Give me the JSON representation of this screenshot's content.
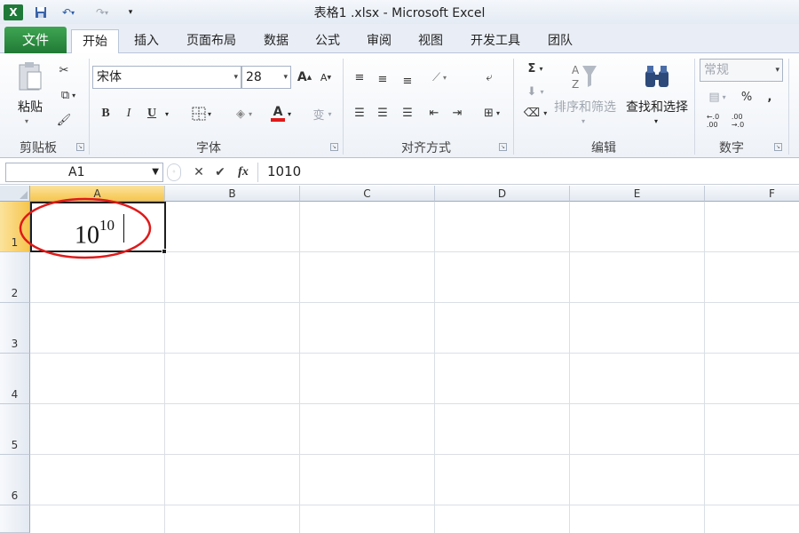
{
  "window": {
    "title": "表格1 .xlsx - Microsoft Excel"
  },
  "tabs": [
    "文件",
    "开始",
    "插入",
    "页面布局",
    "数据",
    "公式",
    "审阅",
    "视图",
    "开发工具",
    "团队"
  ],
  "ribbon": {
    "clipboard": {
      "paste": "粘贴",
      "label": "剪贴板"
    },
    "font": {
      "name": "宋体",
      "size": "28",
      "label": "字体",
      "bold": "B",
      "italic": "I",
      "underline": "U",
      "grow": "A",
      "shrink": "A",
      "color_a": "A",
      "wen": "变"
    },
    "alignment": {
      "label": "对齐方式"
    },
    "editing": {
      "sort": "排序和筛选",
      "find": "查找和选择",
      "label": "编辑",
      "sigma": "Σ"
    },
    "number": {
      "format": "常规",
      "label": "数字",
      "percent": "%",
      "comma": ",",
      "inc": "←.0\n.00",
      "dec": ".00\n→.0"
    }
  },
  "formula_bar": {
    "name_box": "A1",
    "fx": "fx",
    "value": "1010"
  },
  "grid": {
    "columns": [
      "A",
      "B",
      "C",
      "D",
      "E",
      "F"
    ],
    "rows": [
      "1",
      "2",
      "3",
      "4",
      "5",
      "6"
    ],
    "a1": {
      "base": "10",
      "exponent": "10"
    }
  },
  "colors": {
    "selected_header": "#f6c54f",
    "file_tab": "#217a35",
    "annotation": "#e01919"
  }
}
